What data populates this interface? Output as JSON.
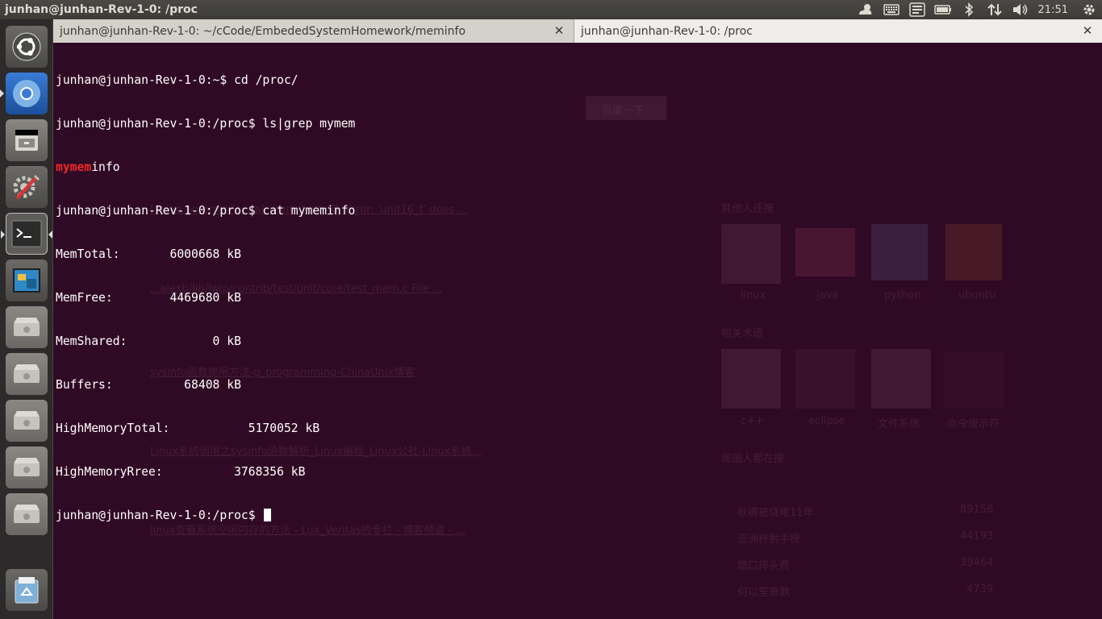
{
  "panel": {
    "title": "junhan@junhan-Rev-1-0: /proc",
    "clock": "21:51",
    "indicators": [
      "weather-icon",
      "keyboard-icon",
      "messaging-icon",
      "battery-icon",
      "bluetooth-icon",
      "network-icon",
      "volume-icon"
    ]
  },
  "launcher": {
    "items": [
      {
        "name": "dash-home-icon"
      },
      {
        "name": "chromium-icon"
      },
      {
        "name": "file-manager-icon"
      },
      {
        "name": "system-settings-icon"
      },
      {
        "name": "terminal-icon"
      },
      {
        "name": "workspace-switcher-icon"
      },
      {
        "name": "drive-icon"
      },
      {
        "name": "drive-icon"
      },
      {
        "name": "drive-icon"
      },
      {
        "name": "drive-icon"
      },
      {
        "name": "drive-icon"
      },
      {
        "name": "trash-icon"
      }
    ]
  },
  "tabs": [
    {
      "label": "junhan@junhan-Rev-1-0: ~/cCode/EmbededSystemHomework/meminfo"
    },
    {
      "label": "junhan@junhan-Rev-1-0: /proc"
    }
  ],
  "terminal": {
    "lines": [
      "junhan@junhan-Rev-1-0:~$ cd /proc/",
      "junhan@junhan-Rev-1-0:/proc$ ls|grep mymem",
      "",
      "junhan@junhan-Rev-1-0:/proc$ cat mymeminfo",
      "MemTotal:       6000668 kB",
      "MemFree:        4469680 kB",
      "MemShared:            0 kB",
      "Buffers:          68408 kB",
      "HighMemoryTotal:           5170052 kB",
      "HighMemoryRree:          3768356 kB",
      "junhan@junhan-Rev-1-0:/proc$ "
    ],
    "grep_match": "mymem",
    "grep_rest": "info"
  },
  "ghost": {
    "search_button": "百度一下",
    "results": [
      "I have an error \"serial_mem_test:48: error: 'unit16_t' does ...",
      "...alexb/lib/lwip/contrib/test/unit/core/test_mem.c File ...",
      "sysinfo函数使用方法-g_programming-ChinaUnix博客",
      "Linux系统调用之sysinfo函数解析_Linux编程_Linux公社-Linux系统...",
      "linux查看系统空闲内存的方法 - Lux_Veritas的专栏 - 博客频道 - ..."
    ],
    "side_headers": [
      "其他人还搜",
      "相关术语",
      "周围人都在搜"
    ],
    "side_labels": [
      "linux",
      "java",
      "python",
      "ubuntu",
      "c++",
      "eclipse",
      "文件系统",
      "命令提示符"
    ],
    "hot_list": [
      "秋裤被烧尾11年",
      "亚洲杯射手榜",
      "踏口摔头费",
      "何以笙箫默"
    ],
    "hot_values": [
      "89156",
      "44193",
      "39464",
      "4739"
    ],
    "colors": {
      "terminal_bg": "#300a24",
      "grep_highlight": "#ef2929",
      "panel_bg": "#3c3b37"
    }
  }
}
